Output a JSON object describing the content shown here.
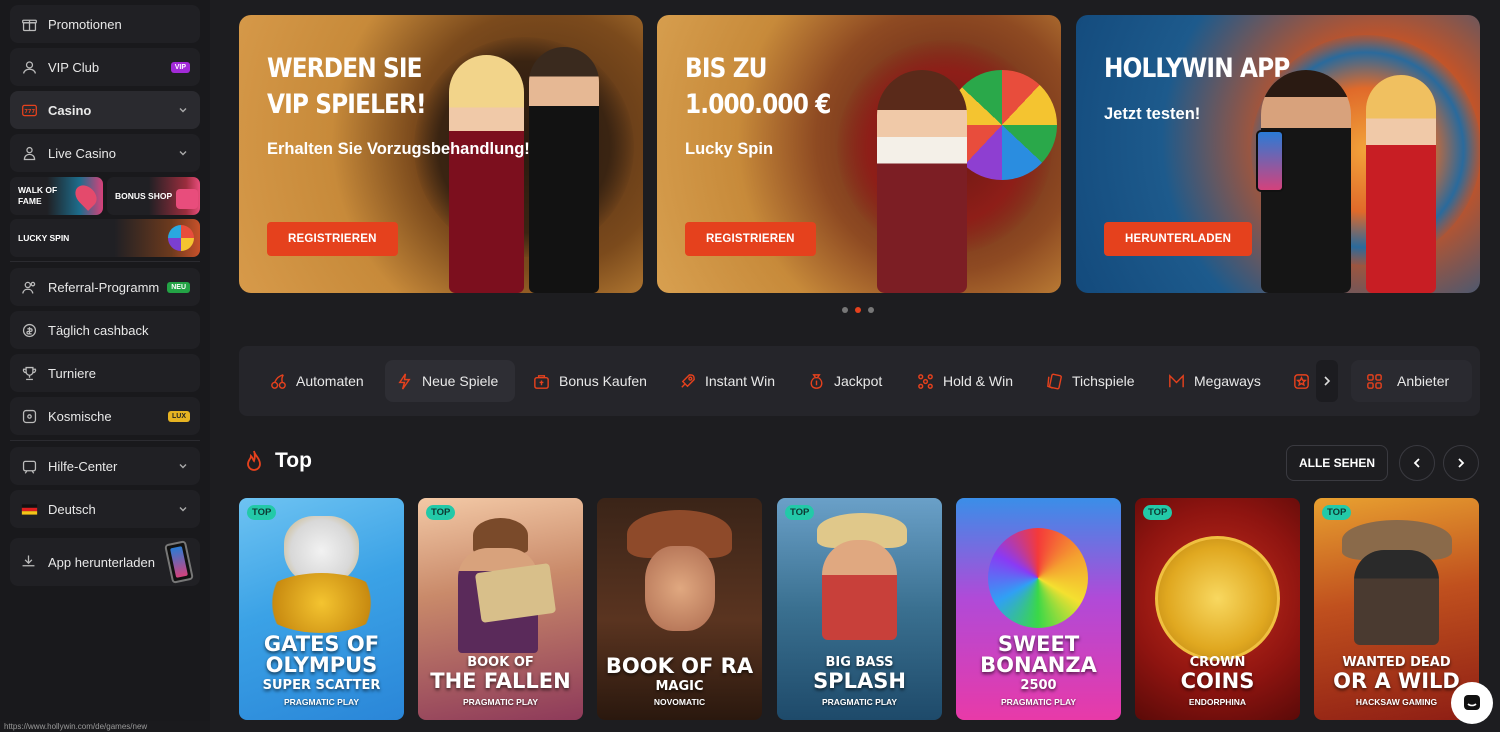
{
  "sidebar": {
    "items": [
      {
        "label": "Promotionen"
      },
      {
        "label": "VIP Club",
        "badge": "VIP"
      },
      {
        "label": "Casino"
      },
      {
        "label": "Live Casino"
      },
      {
        "label": "Referral-Programm",
        "badge": "NEU"
      },
      {
        "label": "Täglich cashback"
      },
      {
        "label": "Turniere"
      },
      {
        "label": "Kosmische",
        "badge": "LUX"
      },
      {
        "label": "Hilfe-Center"
      },
      {
        "label": "Deutsch"
      }
    ],
    "tiles": {
      "walk_of_fame": "WALK OF FAME",
      "bonus_shop": "BONUS SHOP",
      "lucky_spin": "LUCKY SPIN"
    },
    "app_download": "App herunterladen",
    "status_url": "https://www.hollywin.com/de/games/new"
  },
  "banners": [
    {
      "title_line1": "WERDEN SIE",
      "title_line2": "VIP SPIELER!",
      "subtitle": "Erhalten Sie Vorzugsbehandlung!",
      "button": "REGISTRIEREN"
    },
    {
      "title_line1": "BIS ZU",
      "title_line2": "1.000.000 €",
      "subtitle": "Lucky Spin",
      "button": "REGISTRIEREN"
    },
    {
      "title_line1": "HOLLYWIN APP",
      "subtitle": "Jetzt testen!",
      "button": "HERUNTERLADEN"
    }
  ],
  "carousel": {
    "count": 3,
    "active_index": 1
  },
  "categories": [
    {
      "label": "Automaten"
    },
    {
      "label": "Neue Spiele",
      "selected": true
    },
    {
      "label": "Bonus Kaufen"
    },
    {
      "label": "Instant Win"
    },
    {
      "label": "Jackpot"
    },
    {
      "label": "Hold & Win"
    },
    {
      "label": "Tichspiele"
    },
    {
      "label": "Megaways"
    }
  ],
  "providers_button": "Anbieter",
  "top_section": {
    "title": "Top",
    "see_all": "ALLE SEHEN"
  },
  "games": [
    {
      "tag": "TOP",
      "name_line1": "GATES OF",
      "name_line2": "OLYMPUS",
      "name_line3": "SUPER SCATTER",
      "provider": "PRAGMATIC PLAY"
    },
    {
      "tag": "TOP",
      "name_line1": "BOOK OF",
      "name_line2": "THE FALLEN",
      "provider": "PRAGMATIC PLAY"
    },
    {
      "tag": "",
      "name_line1": "BOOK OF RA",
      "name_line2": "MAGIC",
      "provider": "NOVOMATIC"
    },
    {
      "tag": "TOP",
      "name_line1": "BIG BASS",
      "name_line2": "SPLASH",
      "provider": "PRAGMATIC PLAY"
    },
    {
      "tag": "",
      "name_line1": "SWEET",
      "name_line2": "BONANZA",
      "name_line3": "2500",
      "provider": "PRAGMATIC PLAY"
    },
    {
      "tag": "TOP",
      "name_line1": "CROWN",
      "name_line2": "COINS",
      "provider": "ENDORPHINA"
    },
    {
      "tag": "TOP",
      "name_line1": "WANTED DEAD",
      "name_line2": "OR A WILD",
      "provider": "HACKSAW GAMING"
    }
  ],
  "colors": {
    "accent": "#e5411d",
    "background": "#1d1d20",
    "sidebar": "#19191c",
    "top_tag": "#23c9a8"
  }
}
